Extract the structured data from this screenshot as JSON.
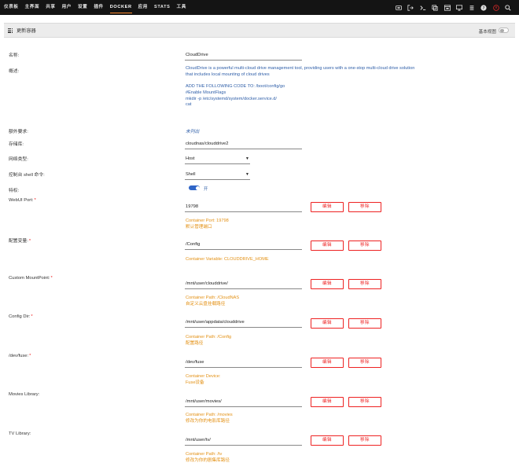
{
  "nav": {
    "items": [
      "仪表板",
      "主界面",
      "共享",
      "用户",
      "设置",
      "插件",
      "DOCKER",
      "应用",
      "STATS",
      "工具"
    ],
    "active": "DOCKER",
    "icons": [
      "info-icon",
      "logout-icon",
      "terminal-icon",
      "copy-icon",
      "window-icon",
      "monitor-icon",
      "list-icon",
      "help-icon",
      "power-icon",
      "search-icon"
    ]
  },
  "header": {
    "title": "更新容器",
    "basic_view_label": "基本视图"
  },
  "form": {
    "name_label": "名称:",
    "name_value": "CloudDrive",
    "overview_label": "概述:",
    "overview_lines": [
      "CloudDrive is a powerful multi-cloud drive management tool, providing users with a one-stop multi-cloud drive solution",
      "that includes local mounting of cloud drives",
      "",
      "ADD THE FOLLOWING CODE TO: /boot/config/go",
      "#Enable MountFlags",
      "mkdir -p /etc/systemd/system/docker.service.d/",
      "cat"
    ],
    "extra_label": "额外要求:",
    "extra_value": "未列出",
    "repo_label": "存储库:",
    "repo_value": "cloudnas/clouddrive2",
    "network_label": "网络类型:",
    "network_value": "Host",
    "console_label": "控制台 shell 命令:",
    "console_value": "Shell",
    "privileged_label": "特权:",
    "privileged_value": "开",
    "edit_label": "编辑",
    "remove_label": "移除"
  },
  "params": [
    {
      "label": "WebUI Port:",
      "required": true,
      "value": "19798",
      "hints": [
        "Container Port: 19798",
        "默认管理端口"
      ]
    },
    {
      "label": "配置变量:",
      "required": true,
      "value": "/Config",
      "hints": [
        "Container Variable: CLOUDDRIVE_HOME"
      ]
    },
    {
      "label": "Custom MountPoint:",
      "required": true,
      "value": "/mnt/user/clouddrive/",
      "hints": [
        "Container Path: /CloudNAS",
        "自定义云盘挂载路径"
      ]
    },
    {
      "label": "Config Dir:",
      "required": true,
      "value": "/mnt/user/appdata/clouddrive",
      "hints": [
        "Container Path: /Config",
        "配置路径"
      ]
    },
    {
      "label": "/dev/fuse:",
      "required": true,
      "value": "/dev/fuse",
      "hints": [
        "Container Device:",
        "Fuse设备"
      ]
    },
    {
      "label": "Movies Library:",
      "required": false,
      "value": "/mnt/user/movies/",
      "hints": [
        "Container Path: /movies",
        "修改为你的电影库路径"
      ]
    },
    {
      "label": "TV Library:",
      "required": false,
      "value": "/mnt/user/tv/",
      "hints": [
        "Container Path: /tv",
        "修改为你的剧集库路径"
      ]
    }
  ],
  "colors": {
    "accent": "#ff8c2f",
    "danger": "#ee2222",
    "link": "#2e5ea8",
    "hint": "#e39013"
  }
}
